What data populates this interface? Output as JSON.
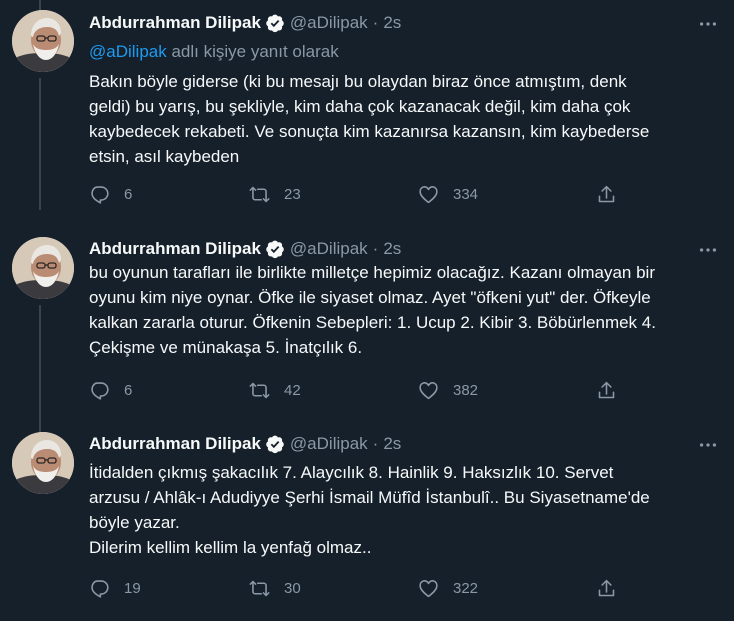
{
  "tweets": [
    {
      "name": "Abdurrahman Dilipak",
      "handle": "@aDilipak",
      "time": "2s",
      "reply_to_handle": "@aDilipak",
      "reply_to_suffix": " adlı kişiye yanıt olarak",
      "text": "Bakın böyle giderse (ki bu mesajı bu olaydan biraz önce atmıştım, denk\ngeldi) bu yarış, bu şekliyle, kim daha çok kazanacak değil, kim daha çok\nkaybedecek rekabeti. Ve sonuçta kim kazanırsa kazansın, kim kaybederse\netsin, asıl kaybeden",
      "replies": "6",
      "retweets": "23",
      "likes": "334"
    },
    {
      "name": "Abdurrahman Dilipak",
      "handle": "@aDilipak",
      "time": "2s",
      "text": "bu oyunun tarafları ile birlikte milletçe hepimiz olacağız. Kazanı olmayan bir\noyunu kim niye oynar. Öfke ile siyaset olmaz. Ayet \"öfkeni yut\" der. Öfkeyle\nkalkan zararla oturur. Öfkenin Sebepleri: 1. Ucup 2. Kibir 3. Böbürlenmek 4.\nÇekişme ve münakaşa 5. İnatçılık 6.",
      "replies": "6",
      "retweets": "42",
      "likes": "382"
    },
    {
      "name": "Abdurrahman Dilipak",
      "handle": "@aDilipak",
      "time": "2s",
      "text": "İtidalden çıkmış şakacılık 7. Alaycılık 8. Hainlik 9. Haksızlık 10. Servet\narzusu / Ahlâk-ı Adudiyye Şerhi İsmail Müfîd İstanbulî.. Bu Siyasetname'de\nböyle yazar.\nDilerim kellim kellim la yenfağ olmaz..",
      "replies": "19",
      "retweets": "30",
      "likes": "322"
    }
  ],
  "icons": {
    "verified": "verified-badge-icon",
    "more": "more-icon",
    "reply": "reply-icon",
    "retweet": "retweet-icon",
    "like": "like-icon",
    "share": "share-icon"
  },
  "colors": {
    "background": "#15202b",
    "text": "#f7f9f9",
    "secondary": "#8b98a5",
    "accent": "#1d9bf0",
    "divider": "#38444d"
  }
}
